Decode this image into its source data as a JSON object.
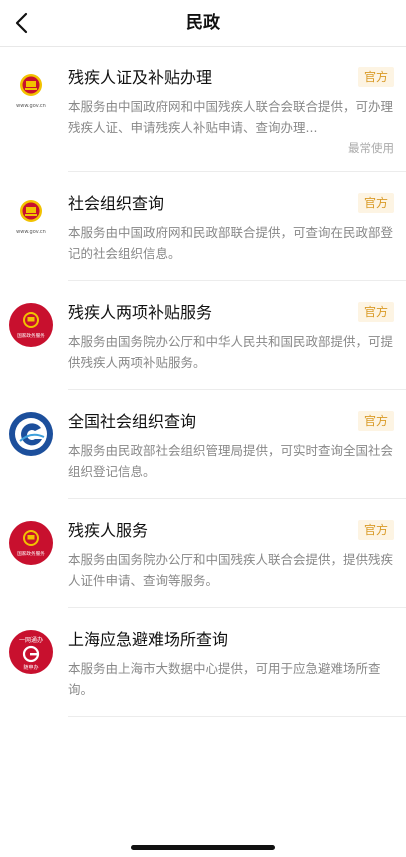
{
  "header": {
    "title": "民政"
  },
  "items": [
    {
      "title": "残疾人证及补贴办理",
      "badge": "官方",
      "desc": "本服务由中国政府网和中国残疾人联合会联合提供，可办理残疾人证、申请残疾人补贴申请、查询办理...",
      "tag": "最常使用",
      "logo_caption": "www.gov.cn",
      "logo_type": "emblem-small"
    },
    {
      "title": "社会组织查询",
      "badge": "官方",
      "desc": "本服务由中国政府网和民政部联合提供，可查询在民政部登记的社会组织信息。",
      "logo_caption": "www.gov.cn",
      "logo_type": "emblem-small"
    },
    {
      "title": "残疾人两项补贴服务",
      "badge": "官方",
      "desc": "本服务由国务院办公厅和中华人民共和国民政部提供，可提供残疾人两项补贴服务。",
      "logo_caption": "国家政务服务",
      "logo_type": "emblem-red-circle"
    },
    {
      "title": "全国社会组织查询",
      "badge": "官方",
      "desc": "本服务由民政部社会组织管理局提供，可实时查询全国社会组织登记信息。",
      "logo_type": "blue-swirl-circle"
    },
    {
      "title": "残疾人服务",
      "badge": "官方",
      "desc": "本服务由国务院办公厅和中国残疾人联合会提供，提供残疾人证件申请、查询等服务。",
      "logo_caption": "国家政务服务",
      "logo_type": "emblem-red-circle"
    },
    {
      "title": "上海应急避难场所查询",
      "desc": "本服务由上海市大数据中心提供，可用于应急避难场所查询。",
      "logo_caption_top": "一网通办",
      "logo_caption_bottom": "随申办",
      "logo_type": "shanghai-red-circle"
    }
  ],
  "colors": {
    "badge_bg": "#fdf4e3",
    "badge_text": "#d99a26",
    "logo_red": "#c8102e",
    "emblem_gold": "#f2c200",
    "logo_blue": "#1c4f9c"
  }
}
